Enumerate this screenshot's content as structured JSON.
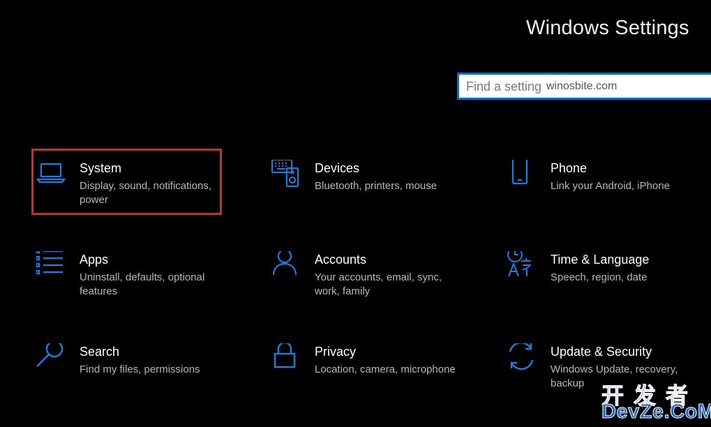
{
  "window": {
    "title": "Windows Settings"
  },
  "search": {
    "placeholder": "Find a setting",
    "watermark_url": "winosbite.com"
  },
  "accent_color": "#1a7fe0",
  "highlight_color": "#d62a2a",
  "tiles": [
    {
      "name": "System",
      "desc": "Display, sound, notifications, power",
      "icon": "laptop-icon"
    },
    {
      "name": "Devices",
      "desc": "Bluetooth, printers, mouse",
      "icon": "keyboard-speaker-icon"
    },
    {
      "name": "Phone",
      "desc": "Link your Android, iPhone",
      "icon": "phone-icon"
    },
    {
      "name": "Apps",
      "desc": "Uninstall, defaults, optional features",
      "icon": "apps-list-icon"
    },
    {
      "name": "Accounts",
      "desc": "Your accounts, email, sync, work, family",
      "icon": "person-icon"
    },
    {
      "name": "Time & Language",
      "desc": "Speech, region, date",
      "icon": "time-language-icon"
    },
    {
      "name": "Search",
      "desc": "Find my files, permissions",
      "icon": "search-icon"
    },
    {
      "name": "Privacy",
      "desc": "Location, camera, microphone",
      "icon": "lock-icon"
    },
    {
      "name": "Update & Security",
      "desc": "Windows Update, recovery, backup",
      "icon": "sync-icon"
    }
  ],
  "watermark": {
    "cn": "开发者",
    "en": "DevZe.CoM"
  }
}
